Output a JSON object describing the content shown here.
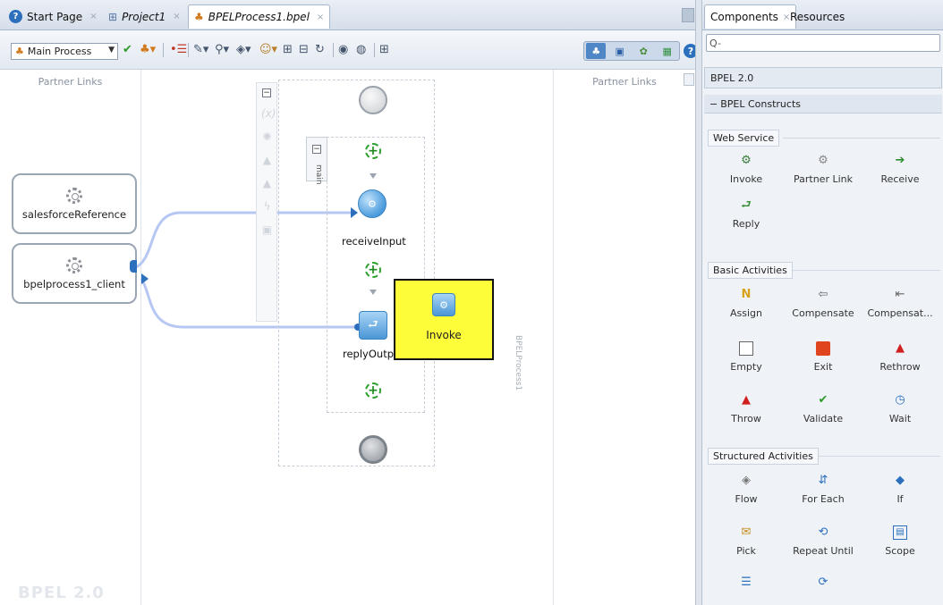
{
  "tabs": [
    {
      "label": "Start Page",
      "icon": "help-circle-icon"
    },
    {
      "label": "Project1",
      "icon": "project-icon"
    },
    {
      "label": "BPELProcess1.bpel",
      "icon": "bpel-process-icon"
    }
  ],
  "toolbar": {
    "process_select": "Main Process"
  },
  "canvas": {
    "partner_links_left": "Partner Links",
    "partner_links_right": "Partner Links",
    "watermark": "BPEL 2.0",
    "scope_outer_label": "BPELProcess1",
    "scope_inner_label": "main",
    "partner_links": [
      "salesforceReference",
      "bpelprocess1_client"
    ],
    "activities": [
      "receiveInput",
      "replyOutpu"
    ],
    "tooltip_label": "Invoke"
  },
  "right_panel": {
    "tabs": [
      "Components",
      "Resources"
    ],
    "search_placeholder": "Q-",
    "library": "BPEL 2.0",
    "category": "BPEL Constructs",
    "groups": [
      {
        "name": "Web Service",
        "items": [
          {
            "label": "Invoke",
            "icon": "invoke-icon"
          },
          {
            "label": "Partner Link",
            "icon": "partner-link-icon"
          },
          {
            "label": "Receive",
            "icon": "receive-icon"
          },
          {
            "label": "Reply",
            "icon": "reply-icon"
          }
        ]
      },
      {
        "name": "Basic Activities",
        "items": [
          {
            "label": "Assign",
            "icon": "assign-icon"
          },
          {
            "label": "Compensate",
            "icon": "compensate-icon"
          },
          {
            "label": "Compensat...",
            "icon": "compensate-scope-icon"
          },
          {
            "label": "Empty",
            "icon": "empty-icon"
          },
          {
            "label": "Exit",
            "icon": "exit-icon"
          },
          {
            "label": "Rethrow",
            "icon": "rethrow-icon"
          },
          {
            "label": "Throw",
            "icon": "throw-icon"
          },
          {
            "label": "Validate",
            "icon": "validate-icon"
          },
          {
            "label": "Wait",
            "icon": "wait-icon"
          }
        ]
      },
      {
        "name": "Structured Activities",
        "items": [
          {
            "label": "Flow",
            "icon": "flow-icon"
          },
          {
            "label": "For Each",
            "icon": "for-each-icon"
          },
          {
            "label": "If",
            "icon": "if-icon"
          },
          {
            "label": "Pick",
            "icon": "pick-icon"
          },
          {
            "label": "Repeat Until",
            "icon": "repeat-until-icon"
          },
          {
            "label": "Scope",
            "icon": "scope-icon"
          },
          {
            "label": "",
            "icon": "sequence-icon"
          },
          {
            "label": "",
            "icon": "while-icon"
          }
        ]
      }
    ]
  },
  "colors": {
    "accent": "#2b6fbd",
    "link_line": "#b6c7f4",
    "tooltip_bg": "#fdfd3a",
    "plus_green": "#2ca02c"
  }
}
